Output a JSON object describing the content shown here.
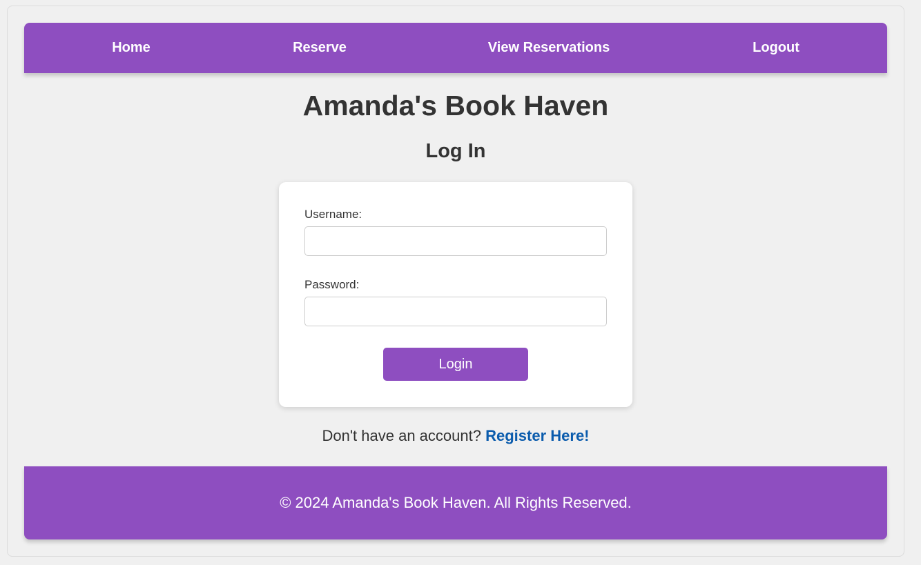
{
  "nav": {
    "items": [
      {
        "label": "Home"
      },
      {
        "label": "Reserve"
      },
      {
        "label": "View Reservations"
      },
      {
        "label": "Logout"
      }
    ]
  },
  "site_title": "Amanda's Book Haven",
  "page_title": "Log In",
  "form": {
    "username_label": "Username:",
    "username_value": "",
    "password_label": "Password:",
    "password_value": "",
    "submit_label": "Login"
  },
  "register": {
    "prompt": "Don't have an account?",
    "link_label": "Register Here!"
  },
  "footer": {
    "text": "© 2024 Amanda's Book Haven. All Rights Reserved."
  },
  "colors": {
    "accent": "#8e4ec0",
    "link": "#0b5cad",
    "background": "#f0f0f0"
  }
}
